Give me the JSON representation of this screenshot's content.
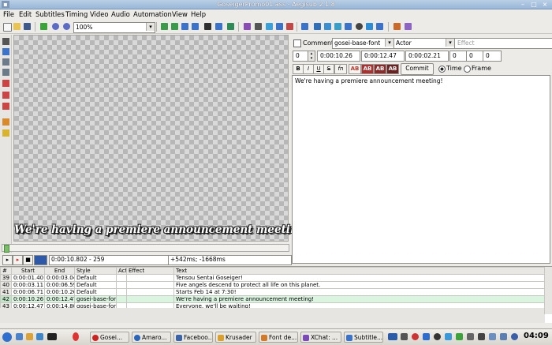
{
  "window": {
    "title": "GoseigerPromo01.ass - Aegisub 2.1.8"
  },
  "menubar": [
    "File",
    "Edit",
    "Subtitles",
    "Timing",
    "Video",
    "Audio",
    "Automation",
    "View",
    "Help"
  ],
  "toolbar": {
    "zoom_value": "100%"
  },
  "video": {
    "subtitle_preview": "We're having a premiere announcement meeting!",
    "current_time": "0:00:10.802 - 259",
    "offset": "+542ms; -1668ms"
  },
  "edit": {
    "comment_label": "Comment",
    "style_value": "gosei-base-font",
    "actor_placeholder": "Actor",
    "effect_placeholder": "Effect",
    "layer": "0",
    "start_time": "0:00:10.26",
    "end_time": "0:00:12.47",
    "duration": "0:00:02.21",
    "margin_l": "0",
    "margin_r": "0",
    "margin_v": "0",
    "format_buttons": [
      "B",
      "I",
      "U",
      "S",
      "fn",
      "AB",
      "AB",
      "AB",
      "AB"
    ],
    "commit_label": "Commit",
    "time_label": "Time",
    "frame_label": "Frame",
    "text": "We're having a premiere announcement meeting!",
    "colors": {
      "c1": "#c0392b",
      "c2": "#b03030",
      "c3": "#8e2a2a",
      "c4": "#6d2222"
    }
  },
  "grid": {
    "headers": [
      "#",
      "Start",
      "End",
      "Style",
      "Act",
      "Effect",
      "Text"
    ],
    "rows": [
      {
        "num": "39",
        "start": "0:00:01.40",
        "end": "0:00:03.04",
        "style": "Default",
        "actor": "",
        "effect": "",
        "text": "Tensou Sentai Goseiger!"
      },
      {
        "num": "40",
        "start": "0:00:03.11",
        "end": "0:00:06.59",
        "style": "Default",
        "actor": "",
        "effect": "",
        "text": "Five angels descend to protect all life on this planet."
      },
      {
        "num": "41",
        "start": "0:00:06.71",
        "end": "0:00:10.26",
        "style": "Default",
        "actor": "",
        "effect": "",
        "text": "Starts Feb 14 at 7:30!"
      },
      {
        "num": "42",
        "start": "0:00:10.26",
        "end": "0:00:12.47",
        "style": "gosei-base-font",
        "actor": "",
        "effect": "",
        "text": "We're having a premiere announcement meeting!"
      },
      {
        "num": "43",
        "start": "0:00:12.47",
        "end": "0:00:14.80",
        "style": "gosei-base-font",
        "actor": "",
        "effect": "",
        "text": "Everyone, we'll be waiting!"
      }
    ],
    "active_index": 3
  },
  "taskbar": {
    "tasks": [
      "Gosei...",
      "Amaro...",
      "Faceboo...",
      "Krusader",
      "Font de...",
      "XChat: ...",
      "Subtitle..."
    ],
    "clock": "04:09"
  }
}
